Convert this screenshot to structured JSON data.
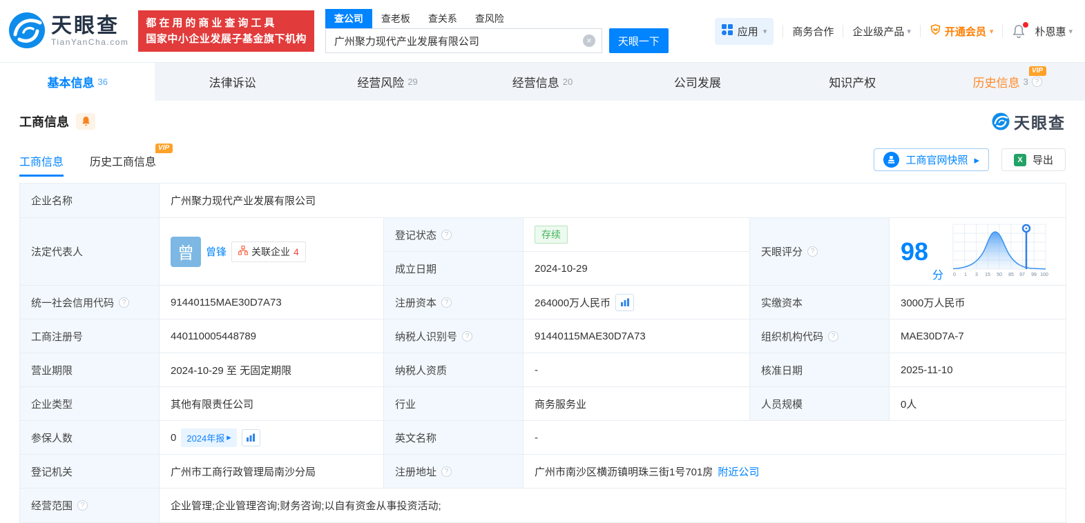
{
  "brand": {
    "name": "天眼查",
    "domain": "TianYanCha.com",
    "slogan_line1": "都在用的商业查询工具",
    "slogan_line2": "国家中小企业发展子基金旗下机构"
  },
  "search": {
    "tabs": [
      "查公司",
      "查老板",
      "查关系",
      "查风险"
    ],
    "value": "广州聚力现代产业发展有限公司",
    "clear": "×",
    "button": "天眼一下"
  },
  "header_nav": {
    "apps": "应用",
    "cooperation": "商务合作",
    "enterprise": "企业级产品",
    "vip": "开通会员",
    "username": "朴恩惠"
  },
  "nav_tabs": [
    {
      "label": "基本信息",
      "count": "36"
    },
    {
      "label": "法律诉讼",
      "count": ""
    },
    {
      "label": "经营风险",
      "count": "29"
    },
    {
      "label": "经营信息",
      "count": "20"
    },
    {
      "label": "公司发展",
      "count": ""
    },
    {
      "label": "知识产权",
      "count": ""
    },
    {
      "label": "历史信息",
      "count": "3",
      "vip": "VIP"
    }
  ],
  "section": {
    "title": "工商信息",
    "subtab_current": "工商信息",
    "subtab_history": "历史工商信息",
    "vip": "VIP",
    "snapshot": "工商官网快照",
    "export": "导出",
    "watermark": "天眼查"
  },
  "table": {
    "company_name_label": "企业名称",
    "company_name": "广州聚力现代产业发展有限公司",
    "legal_rep_label": "法定代表人",
    "legal_rep_avatar": "曾",
    "legal_rep_name": "曾锋",
    "related_label": "关联企业",
    "related_count": "4",
    "reg_status_label": "登记状态",
    "reg_status": "存续",
    "establish_label": "成立日期",
    "establish_date": "2024-10-29",
    "score_label": "天眼评分",
    "uscc_label": "统一社会信用代码",
    "uscc": "91440115MAE30D7A73",
    "reg_capital_label": "注册资本",
    "reg_capital": "264000万人民币",
    "paid_capital_label": "实缴资本",
    "paid_capital": "3000万人民币",
    "reg_no_label": "工商注册号",
    "reg_no": "440110005448789",
    "taxpayer_label": "纳税人识别号",
    "taxpayer_id": "91440115MAE30D7A73",
    "org_code_label": "组织机构代码",
    "org_code": "MAE30D7A-7",
    "term_label": "营业期限",
    "term": "2024-10-29 至 无固定期限",
    "tax_quality_label": "纳税人资质",
    "tax_quality": "-",
    "approve_label": "核准日期",
    "approve_date": "2025-11-10",
    "type_label": "企业类型",
    "company_type": "其他有限责任公司",
    "industry_label": "行业",
    "industry": "商务服务业",
    "staff_label": "人员规模",
    "staff": "0人",
    "insured_label": "参保人数",
    "insured": "0",
    "annual_report": "2024年报",
    "en_name_label": "英文名称",
    "en_name": "-",
    "authority_label": "登记机关",
    "authority": "广州市工商行政管理局南沙分局",
    "address_label": "注册地址",
    "address": "广州市南沙区横沥镇明珠三街1号701房",
    "nearby": "附近公司",
    "scope_label": "经营范围",
    "scope": "企业管理;企业管理咨询;财务咨询;以自有资金从事投资活动;"
  },
  "chart_data": {
    "type": "area",
    "title": "天眼评分",
    "score": "98",
    "unit": "分",
    "x_ticks": [
      "0",
      "1",
      "3",
      "15",
      "50",
      "85",
      "97",
      "99",
      "100"
    ],
    "marker_value": 98,
    "curve_shape": "bell curve peaking near tick 50",
    "accent_color": "#0084ff"
  }
}
